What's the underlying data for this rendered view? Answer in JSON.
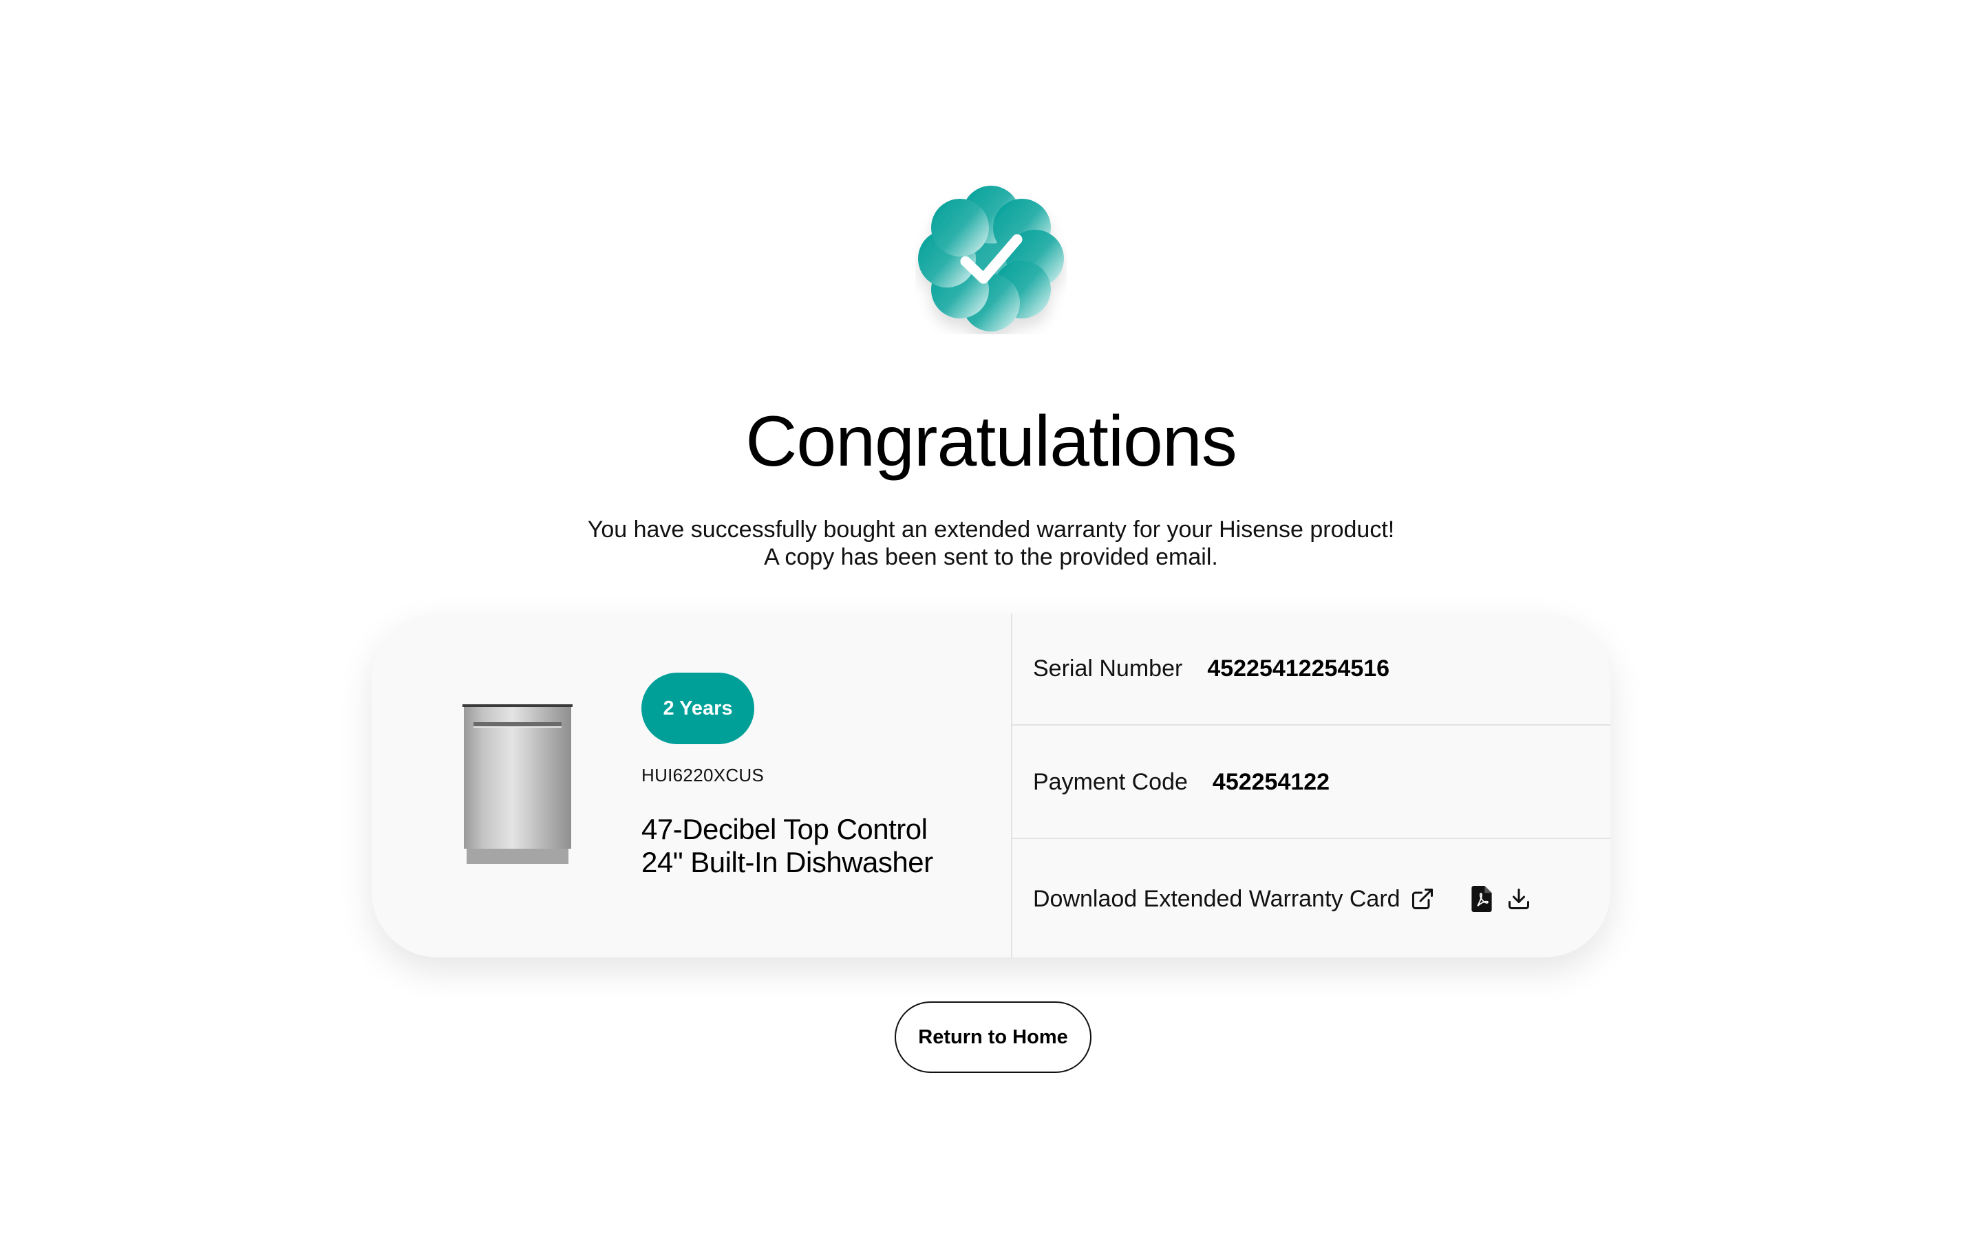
{
  "header": {
    "title": "Congratulations",
    "message_line1": "You have successfully bought an extended warranty for your Hisense product!",
    "message_line2": "A copy has been sent to the provided email.",
    "badge_icon": "check-badge-icon"
  },
  "product": {
    "warranty_term": "2 Years",
    "model": "HUI6220XCUS",
    "name_line1": "47-Decibel Top Control",
    "name_line2": "24\" Built-In Dishwasher",
    "image_icon": "dishwasher-image"
  },
  "details": {
    "serial_label": "Serial Number",
    "serial_value": "45225412254516",
    "payment_label": "Payment Code",
    "payment_value": "452254122",
    "download_label": "Downlaod Extended Warranty Card",
    "icons": [
      "external-link-icon",
      "pdf-file-icon",
      "download-icon"
    ]
  },
  "actions": {
    "return_home": "Return to Home"
  },
  "colors": {
    "accent": "#00a099",
    "card_bg": "#f9f9f9",
    "divider": "#e3e3e3"
  }
}
